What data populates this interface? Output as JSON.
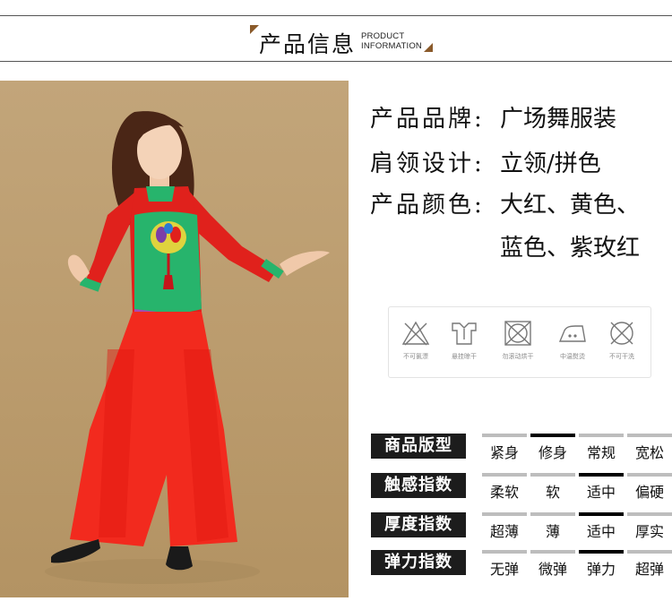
{
  "header": {
    "title": "产品信息",
    "subtitle_line1": "PRODUCT",
    "subtitle_line2": "INFORMATION"
  },
  "info": [
    {
      "label": "产品品牌:",
      "value": "广场舞服装"
    },
    {
      "label": "肩领设计:",
      "value": "立领/拼色"
    },
    {
      "label": "产品颜色:",
      "value": "大红、黄色、"
    },
    {
      "label": "",
      "value": "蓝色、紫玫红"
    }
  ],
  "care": [
    {
      "icon": "no-bleach-icon",
      "label": "不可氯漂"
    },
    {
      "icon": "hang-dry-icon",
      "label": "悬挂晾干"
    },
    {
      "icon": "no-tumble-dry-icon",
      "label": "勿滚动烘干"
    },
    {
      "icon": "medium-iron-icon",
      "label": "中温熨烫"
    },
    {
      "icon": "no-dry-clean-icon",
      "label": "不可干洗"
    }
  ],
  "specs": [
    {
      "label": "商品版型",
      "options": [
        "紧身",
        "修身",
        "常规",
        "宽松"
      ],
      "selected": 1
    },
    {
      "label": "触感指数",
      "options": [
        "柔软",
        "软",
        "适中",
        "偏硬"
      ],
      "selected": 2
    },
    {
      "label": "厚度指数",
      "options": [
        "超薄",
        "薄",
        "适中",
        "厚实"
      ],
      "selected": 2
    },
    {
      "label": "弹力指数",
      "options": [
        "无弹",
        "微弹",
        "弹力",
        "超弹"
      ],
      "selected": 2
    }
  ],
  "colors": {
    "top_red": "#e0211c",
    "vest_green": "#27b46c",
    "pants_red": "#f22a1e",
    "backdrop": "#bfa171",
    "selected_bar": "#000000",
    "unselected_bar": "#bdbdbd"
  }
}
